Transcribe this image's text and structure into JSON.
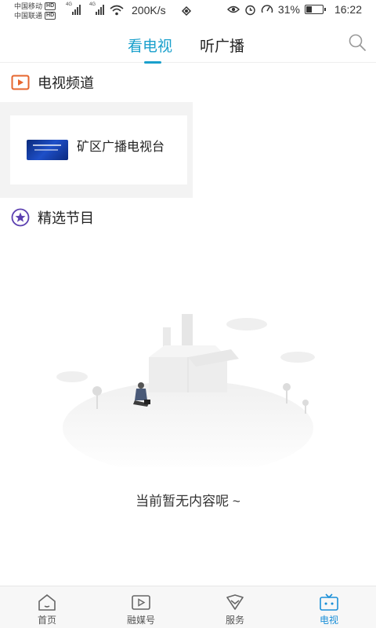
{
  "status_bar": {
    "carrier_1": "中国移动",
    "carrier_2": "中国联通",
    "hd_badge": "HD",
    "network_1": "4G",
    "network_2": "4G",
    "speed": "200K/s",
    "battery_percent": "31%",
    "battery_level": 0.31,
    "time": "16:22",
    "icons": [
      "wifi-icon",
      "nfc-icon",
      "eye-icon",
      "alarm-icon",
      "speedometer-icon",
      "battery-icon"
    ]
  },
  "header": {
    "tab_watch_tv": "看电视",
    "tab_listen_radio": "听广播",
    "active_tab": "看电视",
    "search_icon": "search-icon"
  },
  "tv_channels": {
    "title": "电视频道",
    "icon": "play-square-icon",
    "channels": [
      {
        "name": "矿区广播电视台"
      }
    ]
  },
  "featured": {
    "title": "精选节目",
    "icon": "star-circle-icon",
    "empty_text": "当前暂无内容呢 ~"
  },
  "bottom_nav": {
    "items": [
      {
        "label": "首页",
        "icon": "home-icon"
      },
      {
        "label": "融媒号",
        "icon": "video-icon"
      },
      {
        "label": "服务",
        "icon": "service-icon"
      },
      {
        "label": "电视",
        "icon": "tv-icon"
      }
    ],
    "active": "电视"
  },
  "colors": {
    "accent": "#1aa0cc",
    "nav_active": "#1a8fd8",
    "section_icon_orange": "#e6662e",
    "section_icon_purple": "#5b3fb0"
  }
}
